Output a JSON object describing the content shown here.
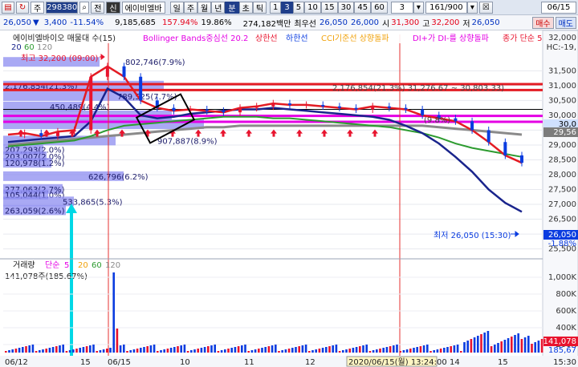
{
  "toolbar": {
    "icons": [
      "chart-icon",
      "refresh-icon"
    ],
    "market": "주",
    "code": "298380",
    "search_label": "전",
    "credit": "신",
    "name": "에이비엘바",
    "periods": [
      "일",
      "주",
      "월",
      "년",
      "분",
      "초",
      "틱"
    ],
    "minutes": [
      "1",
      "3",
      "5",
      "10",
      "15",
      "30",
      "45",
      "60"
    ],
    "count": "3",
    "range": "161/900",
    "cross": "☒",
    "date": "06/15"
  },
  "quote": {
    "price": "26,050",
    "arrow": "▼",
    "change": "3,400",
    "rate": "-11.54%",
    "volume": "9,185,685",
    "vol_ratio": "157.94%",
    "turnover": "19.86%",
    "amount": "274,182백만",
    "pref_label": "최우선",
    "ask": "26,050",
    "bid": "26,000",
    "open_label": "시",
    "open": "31,300",
    "high_label": "고",
    "high": "32,200",
    "low_label": "저",
    "low": "26,050",
    "buy": "매수",
    "sell": "매도"
  },
  "legend": {
    "title": "에이비엘바이오 매물대 수(15)",
    "bollinger": "Bollinger Bands중심선 20.2",
    "upper": "상한선",
    "lower": "하한선",
    "cci": "CCI기준선 상향돌파",
    "dmi": "DI+가 DI-를 상향돌파",
    "close": "종가 단순 5",
    "ma": [
      "20",
      "60",
      "120"
    ]
  },
  "annotations": {
    "high": "최고 32,200 (09:00)",
    "low": "최저 26,050 (15:30)",
    "level_line": "2,176,854(21.3%) 31,276.67 ~ 30,803.33)",
    "mid_tail": "(9.8%)",
    "fib_tail": "1.88%"
  },
  "colors": {
    "up": "#e8142e",
    "down": "#0a3ce0",
    "profile": "#8c8cf0",
    "bb": "#f1a20b",
    "ma5": "#e31b23",
    "ma20": "#19248c",
    "ma60": "#2c9b2f",
    "ma120": "#8a8a8a",
    "magenta": "#e400e4",
    "cyan": "#00d8e6"
  },
  "chart_data": {
    "type": "line",
    "price_axis": {
      "ticks": [
        25500,
        26000,
        26500,
        27000,
        27500,
        28000,
        28500,
        29000,
        29500,
        30000,
        30500,
        31000,
        31500
      ],
      "top_label": "HC:-19,",
      "top_value": "32,000",
      "ylim": [
        25300,
        32400
      ]
    },
    "x_ticks": [
      "06/12",
      "15",
      "06/15",
      "10",
      "11",
      "12",
      "13",
      "14",
      "15"
    ],
    "x_cursor": "2020/06/15(월) 13:24:00",
    "right_tags": {
      "current": "26,050",
      "pct": "-1.88%",
      "ref": "29,56",
      "band": "30,0"
    },
    "volume_profile": [
      {
        "label": "802,746(7.9%)",
        "price": 31800
      },
      {
        "label": "2,176,854(21.3%)",
        "price": 31000
      },
      {
        "label": "789,525(7.7%)",
        "price": 30650
      },
      {
        "label": "450,489(4.4%)",
        "price": 30300
      },
      {
        "label": "",
        "price": 30000
      },
      {
        "label": "",
        "price": 29700
      },
      {
        "label": "907,887(8.9%)",
        "price": 29150
      },
      {
        "label": "207,293(2.0%)",
        "price": 28850
      },
      {
        "label": "203,007(2.0%)",
        "price": 28620
      },
      {
        "label": "120,978(1.2%)",
        "price": 28400
      },
      {
        "label": "626,796(6.2%)",
        "price": 27950
      },
      {
        "label": "277,063(2.7%)",
        "price": 27520
      },
      {
        "label": "105,044(1.0%)",
        "price": 27330
      },
      {
        "label": "533,865(5.3%)",
        "price": 27100
      },
      {
        "label": "263,059(2.6%)",
        "price": 26800
      }
    ],
    "series": [
      {
        "name": "5",
        "values": [
          29350,
          29400,
          29300,
          29450,
          29500,
          31300,
          31650,
          31300,
          30500,
          30250,
          30150,
          30200,
          30150,
          30100,
          30250,
          30300,
          30400,
          30350,
          30350,
          30300,
          30250,
          30200,
          30300,
          30250,
          30200,
          30000,
          29900,
          29800,
          29500,
          29100,
          28650,
          28400
        ]
      },
      {
        "name": "20",
        "values": [
          29100,
          29150,
          29200,
          29250,
          29300,
          29800,
          30900,
          30600,
          30000,
          29900,
          29950,
          30050,
          30100,
          30150,
          30200,
          30200,
          30250,
          30200,
          30150,
          30100,
          30050,
          30000,
          29950,
          29850,
          29650,
          29400,
          29050,
          28600,
          28100,
          27500,
          27050,
          26750
        ]
      },
      {
        "name": "60",
        "values": [
          28950,
          29000,
          29050,
          29100,
          29150,
          29300,
          29500,
          29650,
          29700,
          29750,
          29800,
          29850,
          29900,
          29950,
          29950,
          29950,
          29900,
          29900,
          29850,
          29800,
          29750,
          29700,
          29650,
          29600,
          29500,
          29400,
          29250,
          29050,
          28900,
          28800,
          28700,
          28600
        ]
      },
      {
        "name": "120",
        "values": [
          29000,
          29050,
          29100,
          29150,
          29200,
          29250,
          29300,
          29350,
          29400,
          29450,
          29500,
          29550,
          29600,
          29600,
          29650,
          29650,
          29650,
          29650,
          29650,
          29650,
          29650,
          29650,
          29650,
          29650,
          29650,
          29650,
          29600,
          29550,
          29500,
          29450,
          29400,
          29350
        ]
      }
    ],
    "volume_axis": {
      "ticks": [
        "1,000K",
        "800K",
        "600K",
        "400K",
        "200K"
      ],
      "last": "141,078",
      "pct": "185,67"
    },
    "volume_legend": {
      "name": "거래량",
      "mode": "단순",
      "periods": [
        "5",
        "20",
        "60",
        "120"
      ],
      "value": "141,078주(185.67%)"
    }
  }
}
